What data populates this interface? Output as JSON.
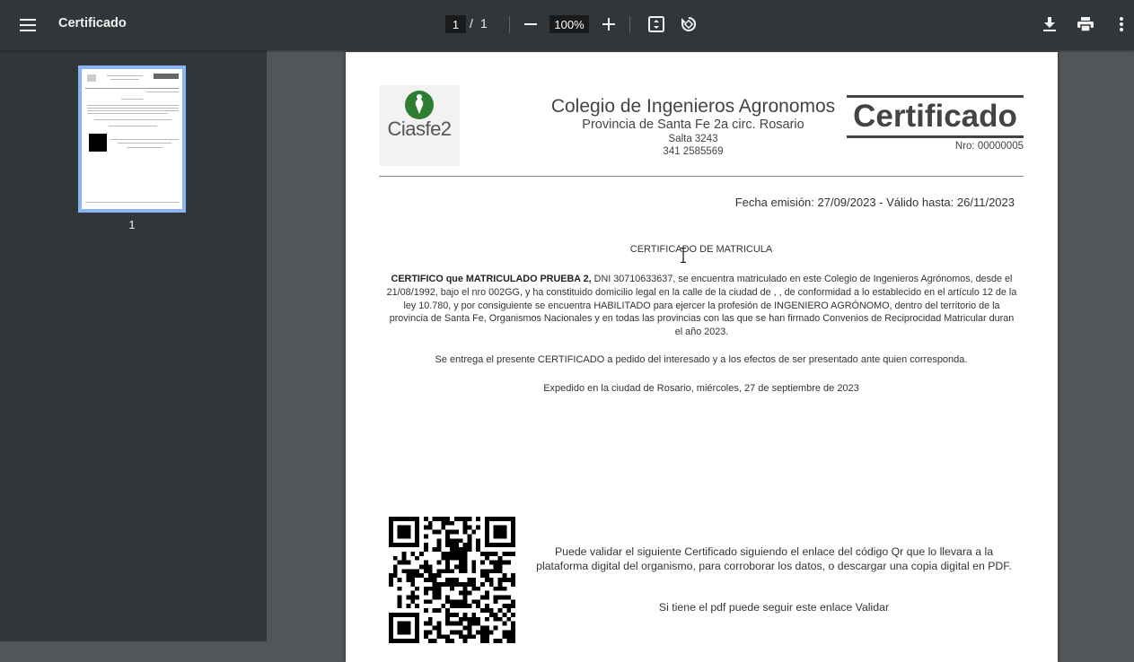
{
  "toolbar": {
    "title": "Certificado",
    "page_current": "1",
    "page_sep": "/",
    "page_total": "1",
    "zoom": "100%",
    "icons": [
      "menu-icon",
      "minus-icon",
      "plus-icon",
      "fit-page-icon",
      "rotate-icon",
      "download-icon",
      "print-icon",
      "more-vert-icon"
    ]
  },
  "sidebar": {
    "thumbnails": [
      {
        "label": "1"
      }
    ]
  },
  "document": {
    "logo_text": "Ciasfe2",
    "org_name": "Colegio de Ingenieros Agronomos",
    "org_sub": "Provincia de Santa Fe 2a circ. Rosario",
    "org_address": "Salta 3243",
    "org_phone": "341 2585569",
    "cert_title": "Certificado",
    "cert_number": "Nro: 00000005",
    "fecha": "Fecha emisión: 27/09/2023 - Válido hasta: 26/11/2023",
    "heading": "CERTIFICADO DE MATRICULA",
    "body_bold": "CERTIFICO que MATRICULADO PRUEBA 2,",
    "body_rest": " DNI 30710633637, se encuentra matriculado en este Colegio de Ingenieros Agrónomos, desde el 21/08/1992, bajo el nro 002GG, y ha constituido domicilio legal en la calle de la ciudad de , , de conformidad a lo establecido en el artículo 12 de la ley 10.780, y por consiguiente se encuentra HABILITADO para ejercer la profesión de INGENIERO AGRÓNOMO, dentro del territorio de la provincia de Santa Fe, Organismos Nacionales y en todas las provincias con las que se han firmado Convenios de Reciprocidad Matricular duran el año 2023.",
    "para2": "Se entrega el presente CERTIFICADO a pedido del interesado y a los efectos de ser presentado ante quien corresponda.",
    "para3": "Expedido en la ciudad de Rosario, miércoles, 27 de septiembre de 2023",
    "validate_text": "Puede validar el siguiente Certificado siguiendo el enlace del código Qr que lo llevara a la plataforma digital del organismo, para corroborar los datos, o descargar una copia digital en PDF.",
    "validate_link_text": "Si tiene el pdf puede seguir este enlace Validar"
  },
  "colors": {
    "toolbar_bg": "#323639",
    "viewer_bg": "#525659",
    "thumb_border": "#8ab4f8",
    "logo_green": "#2e7d32"
  }
}
